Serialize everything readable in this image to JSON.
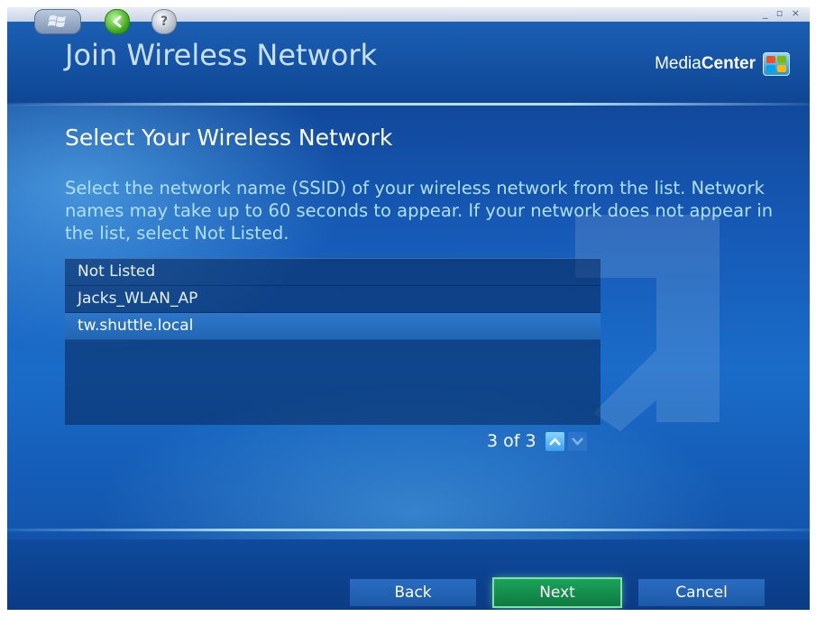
{
  "window": {
    "controls": "_ ▫ ×"
  },
  "header": {
    "title": "Join Wireless Network",
    "brand_light": "Media",
    "brand_bold": "Center"
  },
  "main": {
    "section_title": "Select Your Wireless Network",
    "instructions": "Select the network name (SSID) of your wireless network from the list. Network names may take up to 60 seconds to appear. If your network does not appear in the list, select Not Listed.",
    "networks": [
      {
        "label": "Not Listed",
        "selected": false
      },
      {
        "label": "Jacks_WLAN_AP",
        "selected": false
      },
      {
        "label": "tw.shuttle.local",
        "selected": true
      }
    ],
    "pager": {
      "text": "3 of 3"
    }
  },
  "footer": {
    "back_label": "Back",
    "next_label": "Next",
    "cancel_label": "Cancel"
  },
  "colors": {
    "background": "#1658b4",
    "title_text": "#c8e0ff",
    "instructions_text": "#aee0ff",
    "selected_row": "#2d77c8",
    "next_button": "#1aa35a"
  },
  "icons": {
    "start": "windows-flag-icon",
    "back": "back-arrow-icon",
    "help": "help-icon",
    "brand": "media-center-logo-icon",
    "page_up": "chevron-up-icon",
    "page_down": "chevron-down-icon"
  }
}
